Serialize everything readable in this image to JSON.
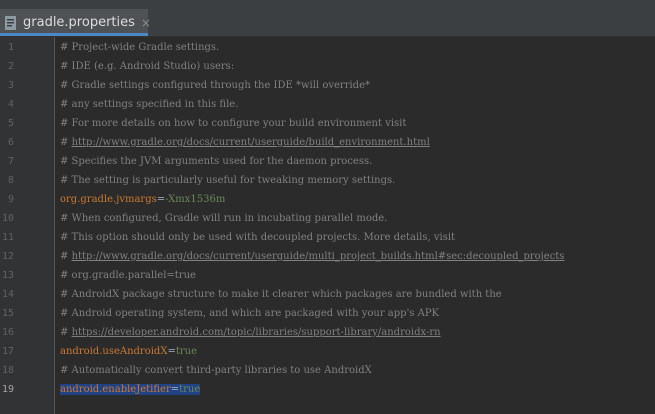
{
  "tab": {
    "title": "gradle.properties",
    "icon": "properties-file-icon",
    "close_glyph": "×"
  },
  "colors": {
    "background": "#2b2b2b",
    "gutter": "#313335",
    "comment": "#808080",
    "key": "#cc7832",
    "value": "#6a8759",
    "selection": "#214283",
    "tab_accent": "#4a88c7"
  },
  "line_numbers": [
    "1",
    "2",
    "3",
    "4",
    "5",
    "6",
    "7",
    "8",
    "9",
    "10",
    "11",
    "12",
    "13",
    "14",
    "15",
    "16",
    "17",
    "18",
    "19"
  ],
  "lines": [
    {
      "text": "# Project-wide Gradle settings."
    },
    {
      "text": "# IDE (e.g. Android Studio) users:"
    },
    {
      "text": "# Gradle settings configured through the IDE *will override*"
    },
    {
      "text": "# any settings specified in this file."
    },
    {
      "text": "# For more details on how to configure your build environment visit"
    },
    {
      "prefix": "# ",
      "link": "http://www.gradle.org/docs/current/userguide/build_environment.html"
    },
    {
      "text": "# Specifies the JVM arguments used for the daemon process."
    },
    {
      "text": "# The setting is particularly useful for tweaking memory settings."
    },
    {
      "key": "org.gradle.jvmargs",
      "eq": "=",
      "value": "-Xmx1536m"
    },
    {
      "text": "# When configured, Gradle will run in incubating parallel mode."
    },
    {
      "text": "# This option should only be used with decoupled projects. More details, visit"
    },
    {
      "prefix": "# ",
      "link": "http://www.gradle.org/docs/current/userguide/multi_project_builds.html#sec:decoupled_projects"
    },
    {
      "text": "# org.gradle.parallel=true"
    },
    {
      "text": "# AndroidX package structure to make it clearer which packages are bundled with the"
    },
    {
      "text": "# Android operating system, and which are packaged with your app's APK"
    },
    {
      "prefix": "# ",
      "link": "https://developer.android.com/topic/libraries/support-library/androidx-rn"
    },
    {
      "key": "android.useAndroidX",
      "eq": "=",
      "value": "true"
    },
    {
      "text": "# Automatically convert third-party libraries to use AndroidX"
    },
    {
      "key": "android.enableJetifier",
      "eq": "=",
      "value": "true"
    }
  ]
}
